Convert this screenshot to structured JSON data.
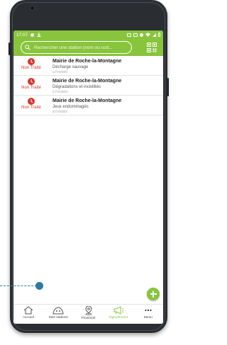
{
  "status_bar": {
    "time": "17:07"
  },
  "search": {
    "placeholder": "Rechercher une station (nom ou cod..."
  },
  "colors": {
    "brand_green": "#88c43c",
    "status_red": "#d8342a",
    "tour_blue": "#2b7aa0"
  },
  "reports": [
    {
      "status": "Non Traité",
      "title": "Mairie de Roche-la-Montagne",
      "category": "Décharge sauvage",
      "time": "à l'instant"
    },
    {
      "status": "Non Traité",
      "title": "Mairie de Roche-la-Montagne",
      "category": "Dégradations et incivilités",
      "time": "à l'instant"
    },
    {
      "status": "Non Traité",
      "title": "Mairie de Roche-la-Montagne",
      "category": "Jeux endommagés",
      "time": "à l'instant"
    }
  ],
  "bottom_nav": [
    {
      "label": "Accueil",
      "icon": "home-icon",
      "active": false
    },
    {
      "label": "Mes stations",
      "icon": "stations-icon",
      "active": false
    },
    {
      "label": "Proximité",
      "icon": "location-pin-icon",
      "active": false
    },
    {
      "label": "Signalement",
      "icon": "megaphone-icon",
      "active": true
    },
    {
      "label": "Menu",
      "icon": "more-dots-icon",
      "active": false
    }
  ]
}
